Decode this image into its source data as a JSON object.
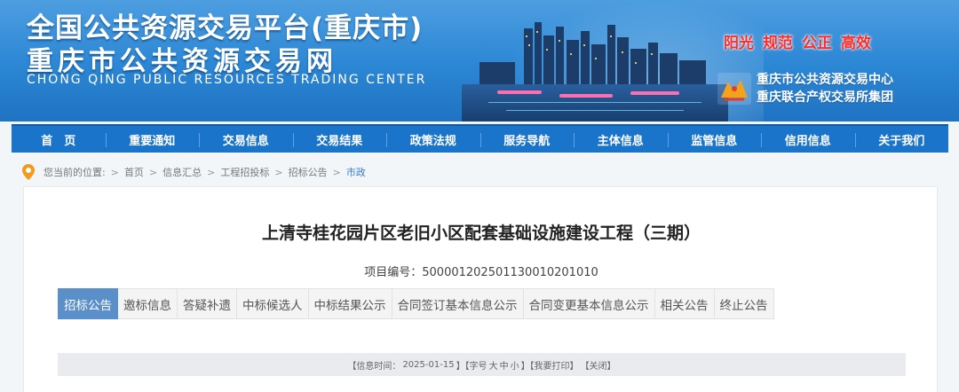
{
  "header": {
    "title_cn_line1": "全国公共资源交易平台(重庆市)",
    "title_cn_line2": "重庆市公共资源交易网",
    "title_en": "CHONG QING PUBLIC RESOURCES TRADING CENTER",
    "slogans": [
      "阳光",
      "规范",
      "公正",
      "高效"
    ],
    "org_line1": "重庆市公共资源交易中心",
    "org_line2": "重庆联合产权交易所集团"
  },
  "nav": {
    "items": [
      "首　页",
      "重要通知",
      "交易信息",
      "交易结果",
      "政策法规",
      "服务导航",
      "主体信息",
      "监管信息",
      "信用信息",
      "关于我们"
    ]
  },
  "breadcrumb": {
    "prefix": "您当前的位置:",
    "items": [
      "首页",
      "信息汇总",
      "工程招投标",
      "招标公告",
      "市政"
    ],
    "separator": ">"
  },
  "document": {
    "title": "上清寺桂花园片区老旧小区配套基础设施建设工程（三期）",
    "project_no_label": "项目编号：",
    "project_no": "500001202501130010201010"
  },
  "tabs": {
    "items": [
      "招标公告",
      "邀标信息",
      "答疑补遗",
      "中标候选人",
      "中标结果公示",
      "合同签订基本信息公示",
      "合同变更基本信息公示",
      "相关公告",
      "终止公告"
    ],
    "active_index": 0
  },
  "info_bar": {
    "time_label": "【信息时间：",
    "time_value": "2025-01-15",
    "font_label": "】【字号",
    "font_large": "大",
    "font_medium": "中",
    "font_small": "小",
    "print_label": "】【我要打印】",
    "close_label": "【关闭】"
  },
  "colors": {
    "nav_bg": "#1a74c9",
    "active_tab": "#5a8fc9",
    "slogan": "#ff2a2a",
    "pin": "#f39a1e"
  }
}
